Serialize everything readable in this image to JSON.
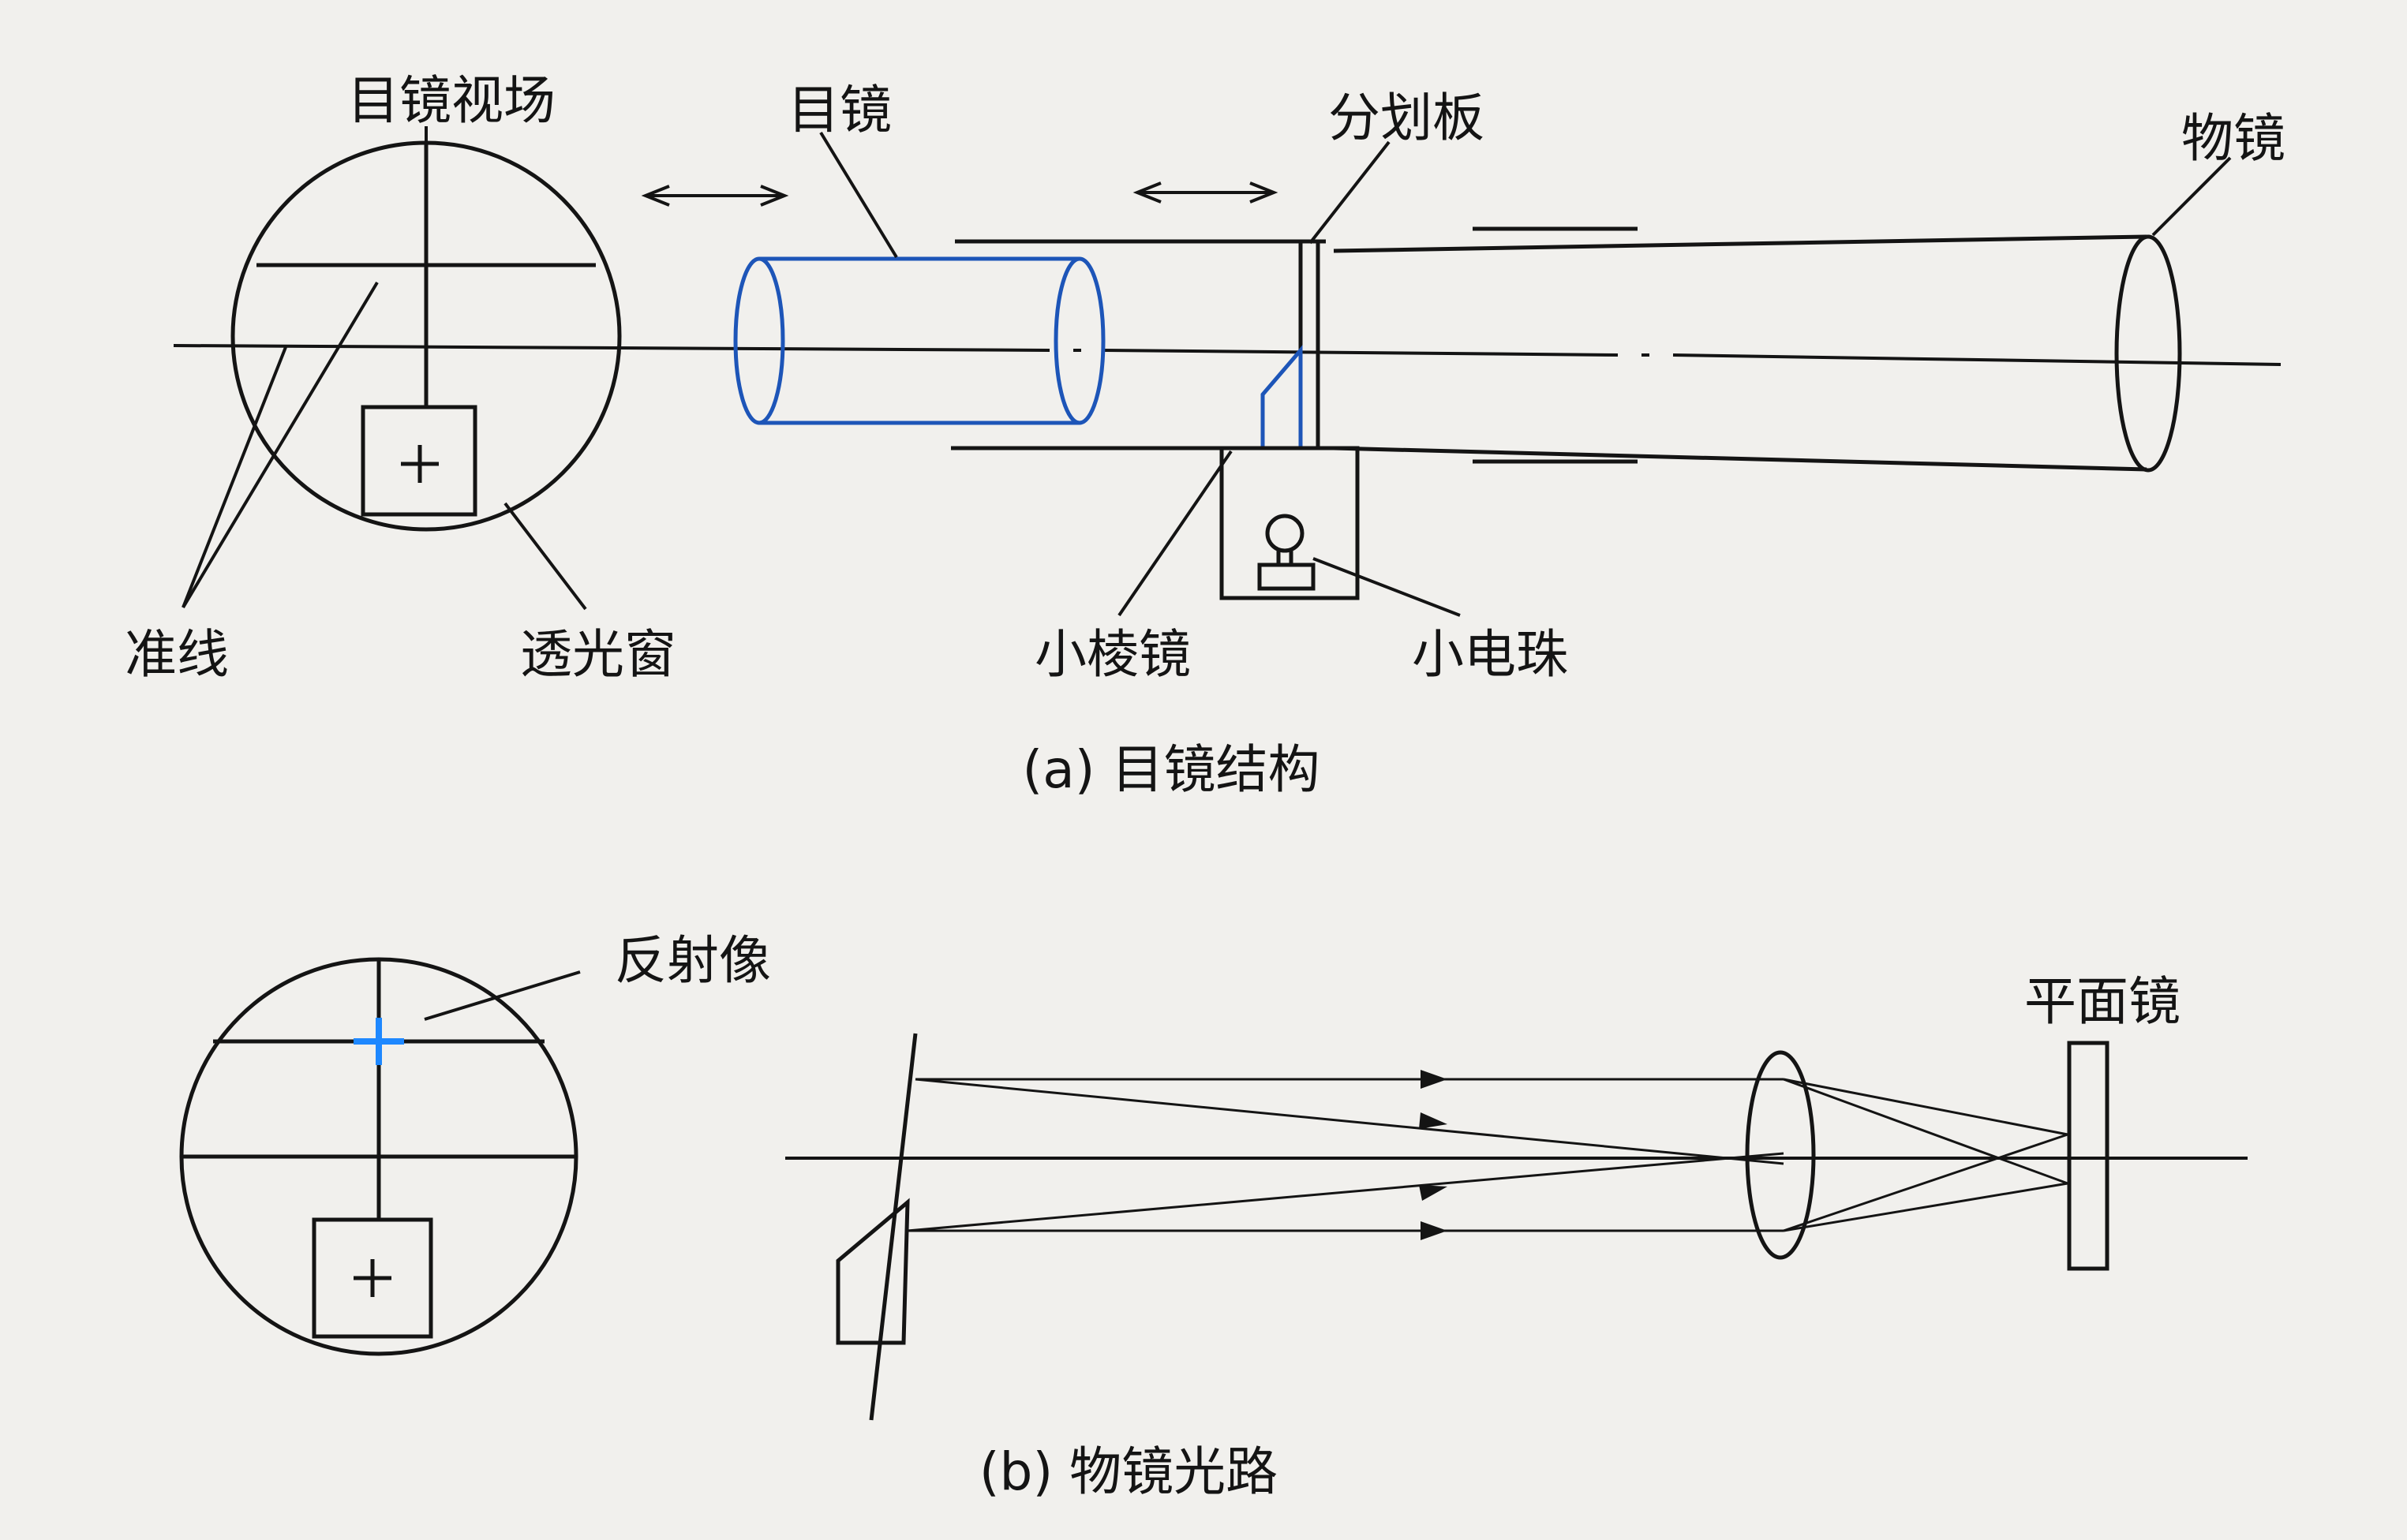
{
  "diagram_a": {
    "labels": {
      "eyepiece_field": "目镜视场",
      "eyepiece": "目镜",
      "reticle": "分划板",
      "objective": "物镜",
      "reticle_lines": "准线",
      "light_window": "透光窗",
      "small_prism": "小棱镜",
      "small_bulb": "小电珠"
    },
    "caption": "(a) 目镜结构"
  },
  "diagram_b": {
    "labels": {
      "reflected_image": "反射像",
      "plane_mirror": "平面镜"
    },
    "caption": "(b) 物镜光路"
  },
  "colors": {
    "ink": "#141414",
    "blue_outline": "#1d55b8",
    "highlight": "#1e88ff",
    "paper": "#f1f0ed"
  }
}
